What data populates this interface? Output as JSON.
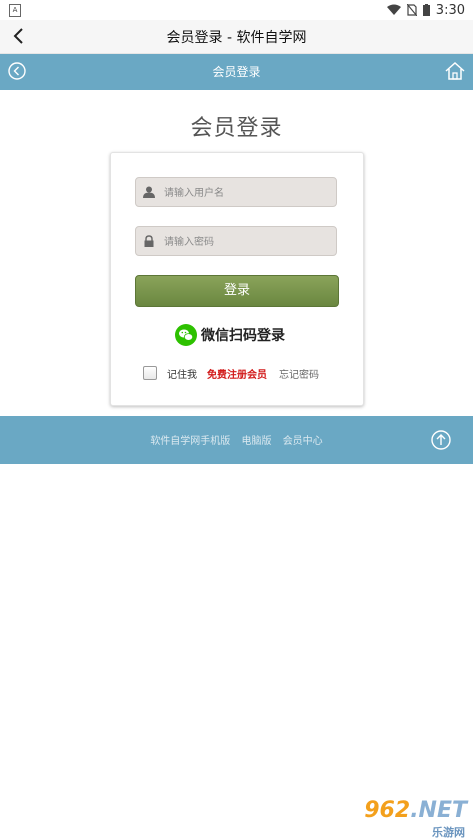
{
  "status": {
    "time": "3:30"
  },
  "appbar": {
    "title": "会员登录 - 软件自学网"
  },
  "navbar": {
    "title": "会员登录"
  },
  "page": {
    "heading": "会员登录"
  },
  "form": {
    "username_placeholder": "请输入用户名",
    "password_placeholder": "请输入密码",
    "login_label": "登录",
    "wechat_label": "微信扫码登录",
    "remember_label": "记住我",
    "register_label": "免费注册会员",
    "forgot_label": "忘记密码"
  },
  "footer": {
    "links": [
      "软件自学网手机版",
      "电脑版",
      "会员中心"
    ]
  },
  "watermark": {
    "brand": "962",
    "suffix": ".NET",
    "sub": "乐游网"
  },
  "colors": {
    "nav_bg": "#6aa8c4",
    "login_btn": "#6a8740",
    "register_text": "#d21a1a",
    "wechat_green": "#2dc100"
  },
  "icons": [
    "back-icon",
    "circle-back-icon",
    "home-icon",
    "user-icon",
    "lock-icon",
    "wechat-icon",
    "arrow-up-icon",
    "wifi-icon",
    "battery-icon"
  ]
}
